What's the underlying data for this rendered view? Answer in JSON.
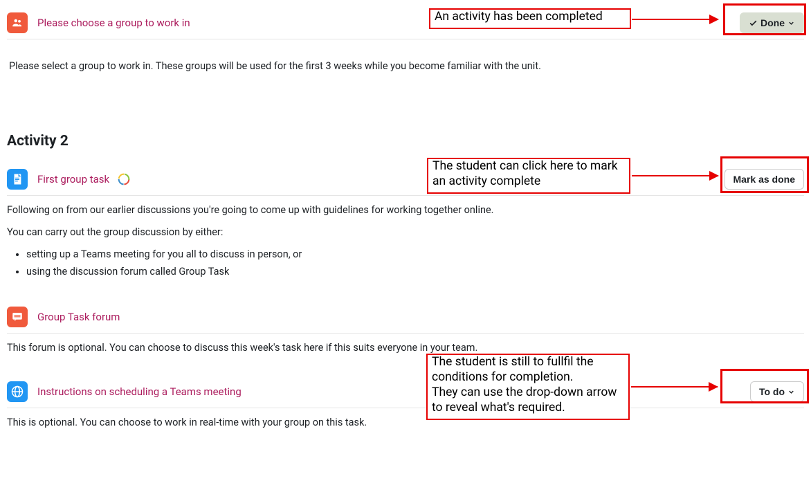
{
  "activity1": {
    "title": "Please choose a group to work in",
    "description": "Please select a group to work in.  These groups will be used for the first 3 weeks while you become familiar with the unit.",
    "callout": "An activity has been completed",
    "button": "Done"
  },
  "section2": {
    "heading": "Activity 2"
  },
  "activity2": {
    "title": "First group task",
    "callout": "The student can click here to mark an activity complete",
    "button": "Mark as done",
    "desc1": "Following on from our earlier discussions you're going to come up with guidelines for working together online.",
    "desc2": "You can carry out the group discussion by either:",
    "bullet1": "setting up a Teams meeting for you all to discuss in person, or",
    "bullet2": "using the discussion forum called Group Task"
  },
  "activity3": {
    "title": "Group Task forum",
    "desc": "This forum is optional.  You can choose to discuss this week's task here if this suits everyone in your team."
  },
  "activity4": {
    "title": "Instructions on scheduling a Teams meeting",
    "callout": "The student is still to fullfil the conditions for completion.\nThey can use the drop-down arrow to reveal what's required.",
    "button": "To do",
    "desc": "This is optional.  You can choose to work in real-time with your group on this task."
  }
}
